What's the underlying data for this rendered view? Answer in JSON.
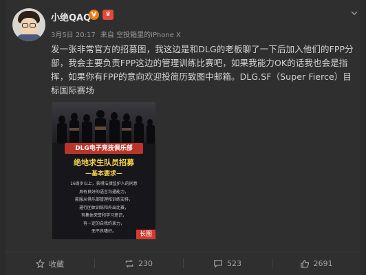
{
  "post": {
    "username": "小绝QAQ",
    "verified_badge": "V",
    "member_badge": "♛",
    "date": "3月5日 20:17",
    "source": "来自 空投箱里的iPhone X",
    "text": "发一张非常官方的招募图，我这边是和DLG的老板聊了一下后加入他们的FPP分部，我会主要负责FPP这边的管理训练比赛吧，如果我能力OK的话我也会是指挥，如果你有FPP的意向欢迎投简历致图中邮箱。DLG.SF（Super Fierce）目标国际赛场"
  },
  "poster": {
    "header": "DLG电子竞技俱乐部",
    "title": "绝地求生队员招募",
    "subtitle": "—基本要求—",
    "lines": [
      "16周岁以上，获得法律监护人的同意",
      "具有良好的语言沟通能力，",
      "能服从俱乐部管理和训练安排，",
      "遵行团体训练和外出比赛，",
      "有集体荣誉和学习意识，",
      "有一定的自我约束力，",
      "无不良嗜好。"
    ],
    "long_tag": "长图"
  },
  "actions": {
    "favorite_label": "收藏",
    "repost_count": "230",
    "comment_count": "523",
    "like_count": "2691"
  },
  "colors": {
    "background": "#2b2b2b",
    "accent_red": "#d23b2f",
    "poster_yellow": "#f2d24a"
  },
  "icons": [
    "star-icon",
    "repost-icon",
    "comment-icon",
    "like-icon",
    "chevron-down-icon"
  ]
}
